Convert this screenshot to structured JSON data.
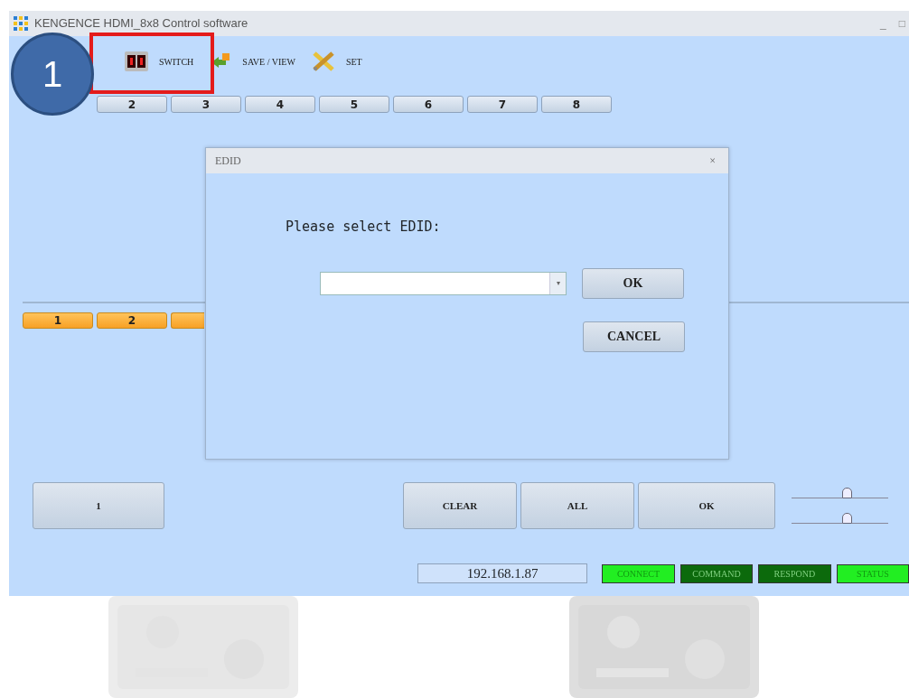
{
  "window": {
    "title": "KENGENCE HDMI_8x8 Control software",
    "controls": [
      "_",
      "□"
    ]
  },
  "toolbar": [
    {
      "label": "SWITCH",
      "kind": "switch",
      "highlighted": true
    },
    {
      "label": "SAVE / VIEW",
      "kind": "save"
    },
    {
      "label": "SET",
      "kind": "set"
    }
  ],
  "annotation": {
    "number": "1"
  },
  "inputs": [
    {
      "label": "2"
    },
    {
      "label": "3"
    },
    {
      "label": "4"
    },
    {
      "label": "5"
    },
    {
      "label": "6"
    },
    {
      "label": "7"
    },
    {
      "label": "8"
    }
  ],
  "outputs": [
    {
      "label": "1"
    },
    {
      "label": "2"
    },
    {
      "kind": "covered"
    }
  ],
  "dialog": {
    "title": "EDID",
    "close": "×",
    "dropdown_arrow": "▾",
    "prompt": "Please select EDID:",
    "ok": "OK",
    "cancel": "CANCEL"
  },
  "bottom": {
    "selected": "1",
    "buttons": [
      "CLEAR",
      "ALL",
      "OK"
    ]
  },
  "sliders": [
    {
      "level": 0.57
    },
    {
      "level": 0.57
    }
  ],
  "status_bar": {
    "ip": "192.168.1.87",
    "indicators": [
      {
        "label": "CONNECT",
        "on": true
      },
      {
        "label": "COMMAND",
        "on": false
      },
      {
        "label": "RESPOND",
        "on": false
      },
      {
        "label": "STATUS",
        "on": true
      }
    ]
  }
}
